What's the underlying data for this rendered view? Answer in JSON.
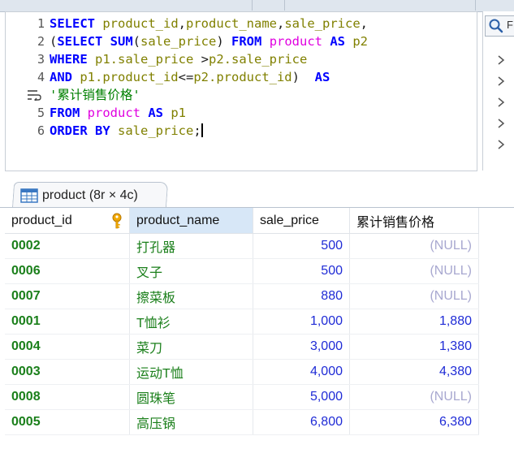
{
  "editor": {
    "lines": [
      {
        "num": "1",
        "segments": [
          {
            "cls": "kw",
            "text": "SELECT "
          },
          {
            "cls": "fld",
            "text": "product_id"
          },
          {
            "cls": "",
            "text": ","
          },
          {
            "cls": "fld",
            "text": "product_name"
          },
          {
            "cls": "",
            "text": ","
          },
          {
            "cls": "fld",
            "text": "sale_price"
          },
          {
            "cls": "",
            "text": ","
          }
        ]
      },
      {
        "num": "2",
        "segments": [
          {
            "cls": "",
            "text": "("
          },
          {
            "cls": "kw",
            "text": "SELECT SUM"
          },
          {
            "cls": "",
            "text": "("
          },
          {
            "cls": "fld",
            "text": "sale_price"
          },
          {
            "cls": "",
            "text": ") "
          },
          {
            "cls": "kw",
            "text": "FROM "
          },
          {
            "cls": "tbl",
            "text": "product"
          },
          {
            "cls": "kw",
            "text": " AS "
          },
          {
            "cls": "fld",
            "text": "p2"
          }
        ]
      },
      {
        "num": "3",
        "segments": [
          {
            "cls": "kw",
            "text": "WHERE "
          },
          {
            "cls": "fld",
            "text": "p1.sale_price"
          },
          {
            "cls": "",
            "text": " >"
          },
          {
            "cls": "fld",
            "text": "p2.sale_price"
          }
        ]
      },
      {
        "num": "4",
        "segments": [
          {
            "cls": "kw",
            "text": "AND "
          },
          {
            "cls": "fld",
            "text": "p1.product_id"
          },
          {
            "cls": "",
            "text": "<="
          },
          {
            "cls": "fld",
            "text": "p2.product_id"
          },
          {
            "cls": "",
            "text": ")  "
          },
          {
            "cls": "kw",
            "text": "AS"
          }
        ]
      },
      {
        "num": "",
        "wrap": true,
        "segments": [
          {
            "cls": "str",
            "text": "'累计销售价格'"
          }
        ]
      },
      {
        "num": "5",
        "segments": [
          {
            "cls": "kw",
            "text": "FROM "
          },
          {
            "cls": "tbl",
            "text": "product"
          },
          {
            "cls": "kw",
            "text": " AS "
          },
          {
            "cls": "fld",
            "text": "p1"
          }
        ]
      },
      {
        "num": "6",
        "cursor": true,
        "segments": [
          {
            "cls": "kw",
            "text": "ORDER BY "
          },
          {
            "cls": "fld",
            "text": "sale_price"
          },
          {
            "cls": "",
            "text": ";"
          }
        ]
      }
    ]
  },
  "right_panel": {
    "search_label": "F",
    "chevron_icon": "chevron-right-icon",
    "chevron_count": 5
  },
  "result_tab": {
    "label": "product (8r × 4c)",
    "icon": "table-grid-icon"
  },
  "result_grid": {
    "columns": [
      "product_id",
      "product_name",
      "sale_price",
      "累计销售价格"
    ],
    "rows": [
      [
        "0002",
        "打孔器",
        "500",
        "(NULL)"
      ],
      [
        "0006",
        "叉子",
        "500",
        "(NULL)"
      ],
      [
        "0007",
        "擦菜板",
        "880",
        "(NULL)"
      ],
      [
        "0001",
        "T恤衫",
        "1,000",
        "1,880"
      ],
      [
        "0004",
        "菜刀",
        "3,000",
        "1,380"
      ],
      [
        "0003",
        "运动T恤",
        "4,000",
        "4,380"
      ],
      [
        "0008",
        "圆珠笔",
        "5,000",
        "(NULL)"
      ],
      [
        "0005",
        "高压锅",
        "6,800",
        "6,380"
      ]
    ]
  },
  "colors": {
    "keyword": "#0000ff",
    "table": "#e000e0",
    "field": "#808000",
    "string": "#008000",
    "id_cell": "#1a7f1a",
    "number_cell": "#1f2bd6",
    "null_cell": "#a8a8d0",
    "selected_header": "#d7e7f7"
  }
}
